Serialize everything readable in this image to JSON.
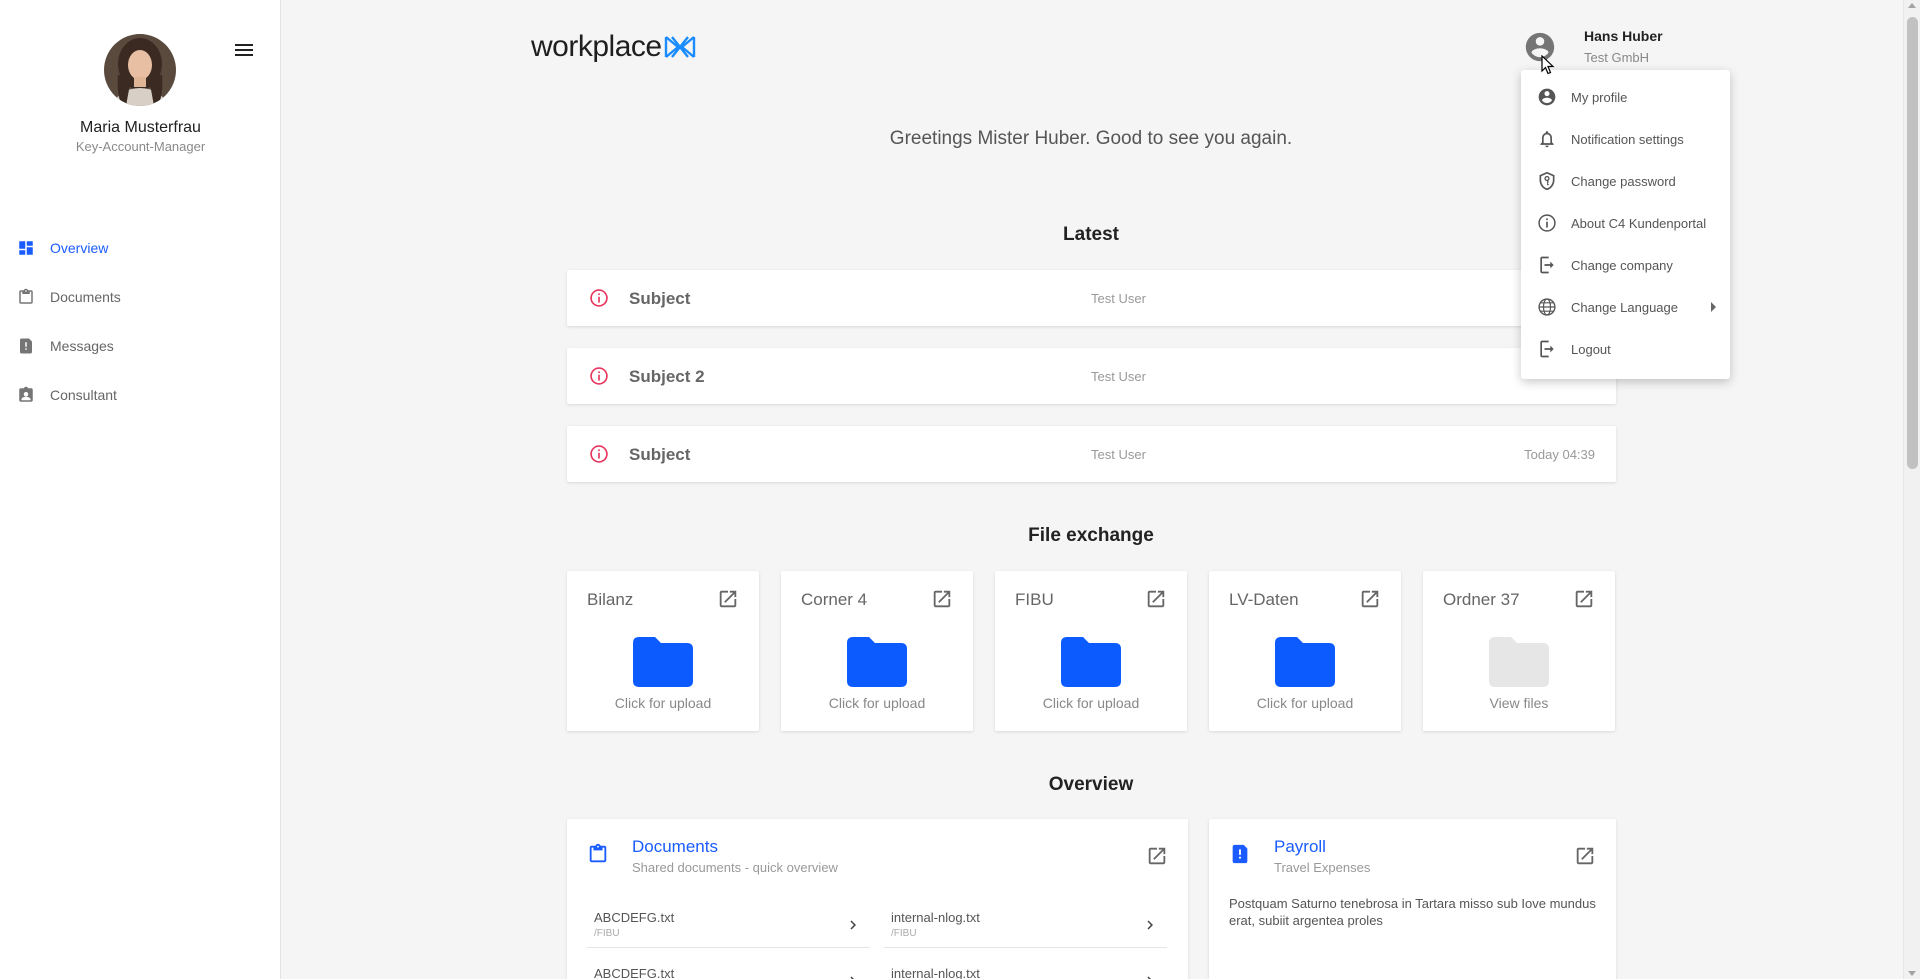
{
  "sidebar": {
    "user_name": "Maria Musterfrau",
    "user_role": "Key-Account-Manager",
    "nav": [
      {
        "label": "Overview",
        "icon": "dashboard-icon",
        "active": true
      },
      {
        "label": "Documents",
        "icon": "clipboard-icon"
      },
      {
        "label": "Messages",
        "icon": "message-alert-icon"
      },
      {
        "label": "Consultant",
        "icon": "contact-badge-icon"
      }
    ]
  },
  "header": {
    "logo_text": "workplace",
    "user_name": "Hans Huber",
    "company": "Test GmbH"
  },
  "user_menu": {
    "items": [
      {
        "label": "My profile",
        "icon": "account-circle-icon"
      },
      {
        "label": "Notification settings",
        "icon": "bell-icon"
      },
      {
        "label": "Change password",
        "icon": "shield-key-icon"
      },
      {
        "label": "About C4 Kundenportal",
        "icon": "info-icon"
      },
      {
        "label": "Change company",
        "icon": "exit-icon"
      },
      {
        "label": "Change Language",
        "icon": "globe-icon",
        "submenu": true
      },
      {
        "label": "Logout",
        "icon": "logout-icon"
      }
    ]
  },
  "main": {
    "greeting": "Greetings Mister Huber. Good to see you again.",
    "latest": {
      "title": "Latest",
      "items": [
        {
          "subject": "Subject",
          "sender": "Test User",
          "time": ""
        },
        {
          "subject": "Subject 2",
          "sender": "Test User",
          "time": ""
        },
        {
          "subject": "Subject",
          "sender": "Test User",
          "time": "Today 04:39"
        }
      ]
    },
    "file_exchange": {
      "title": "File exchange",
      "folders": [
        {
          "name": "Bilanz",
          "hint": "Click for upload",
          "color": "#0b5bff"
        },
        {
          "name": "Corner 4",
          "hint": "Click for upload",
          "color": "#0b5bff"
        },
        {
          "name": "FIBU",
          "hint": "Click for upload",
          "color": "#0b5bff"
        },
        {
          "name": "LV-Daten",
          "hint": "Click for upload",
          "color": "#0b5bff"
        },
        {
          "name": "Ordner 37",
          "hint": "View files",
          "color": "#e6e6e6"
        }
      ]
    },
    "overview": {
      "title": "Overview",
      "documents": {
        "title": "Documents",
        "subtitle": "Shared documents - quick overview",
        "items": [
          {
            "name": "ABCDEFG.txt",
            "path": "/FIBU"
          },
          {
            "name": "internal-nlog.txt",
            "path": "/FIBU"
          },
          {
            "name": "ABCDEFG.txt",
            "path": ""
          },
          {
            "name": "internal-nlog.txt",
            "path": ""
          }
        ]
      },
      "payroll": {
        "title": "Payroll",
        "subtitle": "Travel Expenses",
        "text": "Postquam Saturno tenebrosa in Tartara misso sub Iove mundus erat, subiit argentea proles"
      }
    }
  },
  "colors": {
    "accent": "#1a5cff",
    "alert": "#e8375f"
  }
}
